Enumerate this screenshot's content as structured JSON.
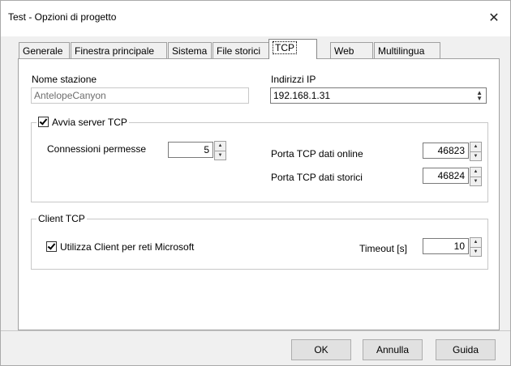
{
  "window": {
    "title": "Test - Opzioni di progetto",
    "close_glyph": "✕"
  },
  "tabs": [
    {
      "label": "Generale"
    },
    {
      "label": "Finestra principale"
    },
    {
      "label": "Sistema"
    },
    {
      "label": "File storici"
    },
    {
      "label": "TCP",
      "active": true
    },
    {
      "label": "Web"
    },
    {
      "label": "Multilingua"
    }
  ],
  "station": {
    "label": "Nome stazione",
    "value": "AntelopeCanyon"
  },
  "ip": {
    "label": "Indirizzi IP",
    "value": "192.168.1.31"
  },
  "server": {
    "title": "Avvia server TCP",
    "checked": true,
    "connections_label": "Connessioni permesse",
    "connections_value": "5",
    "online_port_label": "Porta TCP dati online",
    "online_port_value": "46823",
    "history_port_label": "Porta TCP dati storici",
    "history_port_value": "46824"
  },
  "client": {
    "title": "Client TCP",
    "ms_label": "Utilizza Client per reti Microsoft",
    "ms_checked": true,
    "timeout_label": "Timeout [s]",
    "timeout_value": "10"
  },
  "buttons": {
    "ok": "OK",
    "cancel": "Annulla",
    "help": "Guida"
  }
}
